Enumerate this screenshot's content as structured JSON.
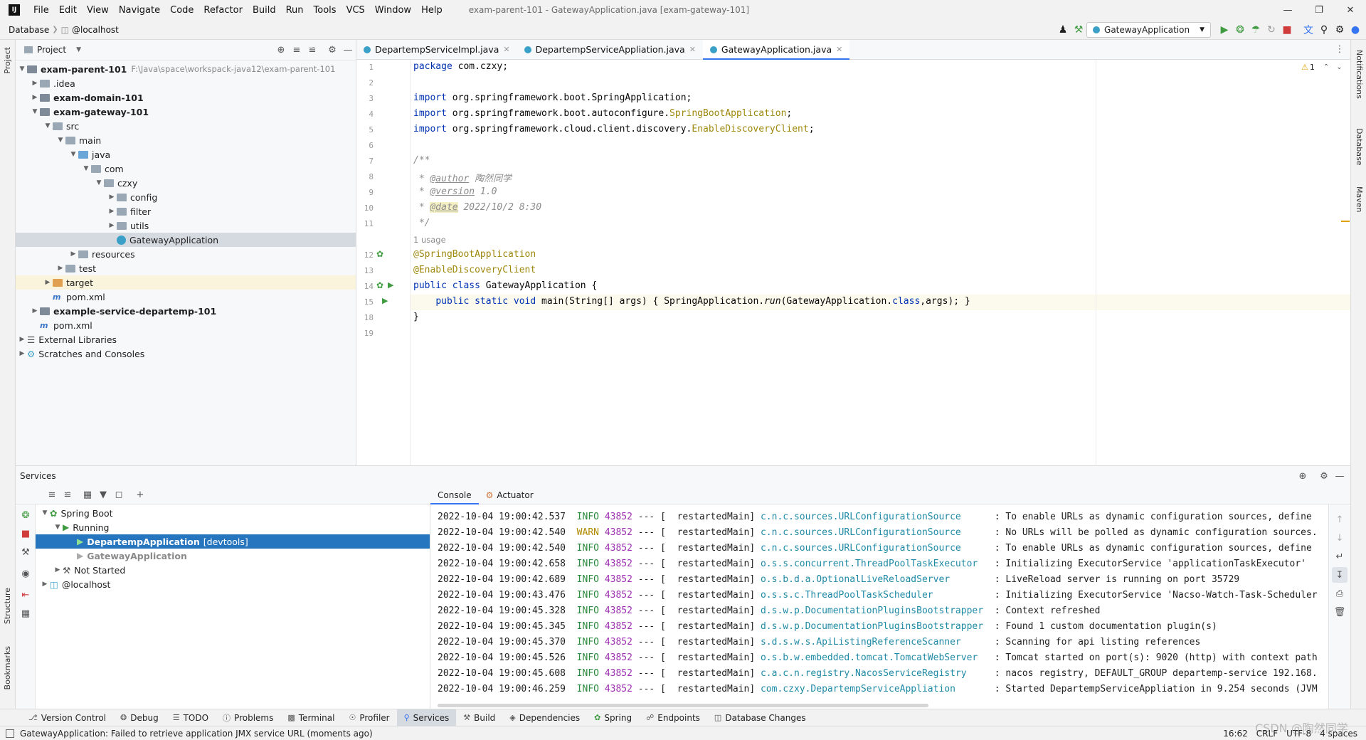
{
  "menubar": {
    "items": [
      "File",
      "Edit",
      "View",
      "Navigate",
      "Code",
      "Refactor",
      "Build",
      "Run",
      "Tools",
      "VCS",
      "Window",
      "Help"
    ],
    "window_title": "exam-parent-101 - GatewayApplication.java [exam-gateway-101]"
  },
  "navbar": {
    "crumbs": [
      "Database",
      "@localhost"
    ],
    "run_config": "GatewayApplication"
  },
  "stripes": {
    "left": [
      "Project",
      "Structure",
      "Bookmarks"
    ],
    "right": [
      "Notifications",
      "Database",
      "Maven"
    ]
  },
  "project": {
    "title": "Project",
    "tree": [
      {
        "label": "exam-parent-101",
        "path": "F:\\Java\\space\\workspack-java12\\exam-parent-101",
        "bold": true
      },
      {
        "label": ".idea"
      },
      {
        "label": "exam-domain-101",
        "bold": true
      },
      {
        "label": "exam-gateway-101",
        "bold": true
      },
      {
        "label": "src"
      },
      {
        "label": "main"
      },
      {
        "label": "java"
      },
      {
        "label": "com"
      },
      {
        "label": "czxy"
      },
      {
        "label": "config"
      },
      {
        "label": "filter"
      },
      {
        "label": "utils"
      },
      {
        "label": "GatewayApplication"
      },
      {
        "label": "resources"
      },
      {
        "label": "test"
      },
      {
        "label": "target"
      },
      {
        "label": "pom.xml"
      },
      {
        "label": "example-service-departemp-101",
        "bold": true
      },
      {
        "label": "pom.xml"
      },
      {
        "label": "External Libraries"
      },
      {
        "label": "Scratches and Consoles"
      }
    ]
  },
  "editor": {
    "tabs": [
      "DepartempServiceImpl.java",
      "DepartempServiceAppliation.java",
      "GatewayApplication.java"
    ],
    "warning_count": "1",
    "line_numbers": [
      "1",
      "2",
      "3",
      "4",
      "5",
      "6",
      "7",
      "8",
      "9",
      "10",
      "11",
      "12",
      "13",
      "14",
      "15",
      "18",
      "19"
    ],
    "usage_hint": "1 usage",
    "code": {
      "l1_kw": "package",
      "l1_rest": " com.czxy;",
      "l3_kw": "import",
      "l3_rest": " org.springframework.boot.SpringApplication;",
      "l4_kw": "import",
      "l4_a": " org.springframework.boot.autoconfigure.",
      "l4_ann": "SpringBootApplication",
      "l4_end": ";",
      "l5_kw": "import",
      "l5_a": " org.springframework.cloud.client.discovery.",
      "l5_ann": "EnableDiscoveryClient",
      "l5_end": ";",
      "l7": "/**",
      "l8_pre": " * ",
      "l8_tag": "@author",
      "l8_val": " 陶然同学",
      "l9_pre": " * ",
      "l9_tag": "@version",
      "l9_val": " 1.0",
      "l10_pre": " * ",
      "l10_tag": "@date",
      "l10_val": " 2022/10/2 8:30",
      "l11": " */",
      "l12": "@SpringBootApplication",
      "l13": "@EnableDiscoveryClient",
      "l14_kw": "public class",
      "l14_rest": " GatewayApplication {",
      "l15_indent": "    ",
      "l15_kw": "public static void",
      "l15_a": " main(String[] args) { SpringApplication.",
      "l15_run": "run",
      "l15_b": "(GatewayApplication.",
      "l15_class": "class",
      "l15_c": ",args); }",
      "l18": "}"
    }
  },
  "services": {
    "title": "Services",
    "tree": [
      {
        "label": "Spring Boot"
      },
      {
        "label": "Running"
      },
      {
        "label": "DepartempApplication",
        "suffix": "[devtools]"
      },
      {
        "label": "GatewayApplication"
      },
      {
        "label": "Not Started"
      },
      {
        "label": "@localhost"
      }
    ],
    "console_tabs": [
      "Console",
      "Actuator"
    ],
    "log_lines": [
      {
        "ts": "2022-10-04 19:00:42.537",
        "lvl": "INFO",
        "pid": "43852",
        "thread": "restartedMain",
        "logger": "c.n.c.sources.URLConfigurationSource     ",
        "msg": ": To enable URLs as dynamic configuration sources, define"
      },
      {
        "ts": "2022-10-04 19:00:42.540",
        "lvl": "WARN",
        "pid": "43852",
        "thread": "restartedMain",
        "logger": "c.n.c.sources.URLConfigurationSource     ",
        "msg": ": No URLs will be polled as dynamic configuration sources."
      },
      {
        "ts": "2022-10-04 19:00:42.540",
        "lvl": "INFO",
        "pid": "43852",
        "thread": "restartedMain",
        "logger": "c.n.c.sources.URLConfigurationSource     ",
        "msg": ": To enable URLs as dynamic configuration sources, define"
      },
      {
        "ts": "2022-10-04 19:00:42.658",
        "lvl": "INFO",
        "pid": "43852",
        "thread": "restartedMain",
        "logger": "o.s.s.concurrent.ThreadPoolTaskExecutor  ",
        "msg": ": Initializing ExecutorService 'applicationTaskExecutor'"
      },
      {
        "ts": "2022-10-04 19:00:42.689",
        "lvl": "INFO",
        "pid": "43852",
        "thread": "restartedMain",
        "logger": "o.s.b.d.a.OptionalLiveReloadServer       ",
        "msg": ": LiveReload server is running on port 35729"
      },
      {
        "ts": "2022-10-04 19:00:43.476",
        "lvl": "INFO",
        "pid": "43852",
        "thread": "restartedMain",
        "logger": "o.s.s.c.ThreadPoolTaskScheduler          ",
        "msg": ": Initializing ExecutorService 'Nacso-Watch-Task-Scheduler"
      },
      {
        "ts": "2022-10-04 19:00:45.328",
        "lvl": "INFO",
        "pid": "43852",
        "thread": "restartedMain",
        "logger": "d.s.w.p.DocumentationPluginsBootstrapper ",
        "msg": ": Context refreshed"
      },
      {
        "ts": "2022-10-04 19:00:45.345",
        "lvl": "INFO",
        "pid": "43852",
        "thread": "restartedMain",
        "logger": "d.s.w.p.DocumentationPluginsBootstrapper ",
        "msg": ": Found 1 custom documentation plugin(s)"
      },
      {
        "ts": "2022-10-04 19:00:45.370",
        "lvl": "INFO",
        "pid": "43852",
        "thread": "restartedMain",
        "logger": "s.d.s.w.s.ApiListingReferenceScanner     ",
        "msg": ": Scanning for api listing references"
      },
      {
        "ts": "2022-10-04 19:00:45.526",
        "lvl": "INFO",
        "pid": "43852",
        "thread": "restartedMain",
        "logger": "o.s.b.w.embedded.tomcat.TomcatWebServer  ",
        "msg": ": Tomcat started on port(s): 9020 (http) with context path"
      },
      {
        "ts": "2022-10-04 19:00:45.608",
        "lvl": "INFO",
        "pid": "43852",
        "thread": "restartedMain",
        "logger": "c.a.c.n.registry.NacosServiceRegistry    ",
        "msg": ": nacos registry, DEFAULT_GROUP departemp-service 192.168."
      },
      {
        "ts": "2022-10-04 19:00:46.259",
        "lvl": "INFO",
        "pid": "43852",
        "thread": "restartedMain",
        "logger": "com.czxy.DepartempServiceAppliation      ",
        "msg": ": Started DepartempServiceAppliation in 9.254 seconds (JVM"
      }
    ]
  },
  "toolwindows": [
    "Version Control",
    "Debug",
    "TODO",
    "Problems",
    "Terminal",
    "Profiler",
    "Services",
    "Build",
    "Dependencies",
    "Spring",
    "Endpoints",
    "Database Changes"
  ],
  "status": {
    "message": "GatewayApplication: Failed to retrieve application JMX service URL (moments ago)",
    "position": "16:62",
    "line_sep": "CRLF",
    "encoding": "UTF-8",
    "indent": "4 spaces"
  },
  "watermark": "CSDN @陶然同学"
}
